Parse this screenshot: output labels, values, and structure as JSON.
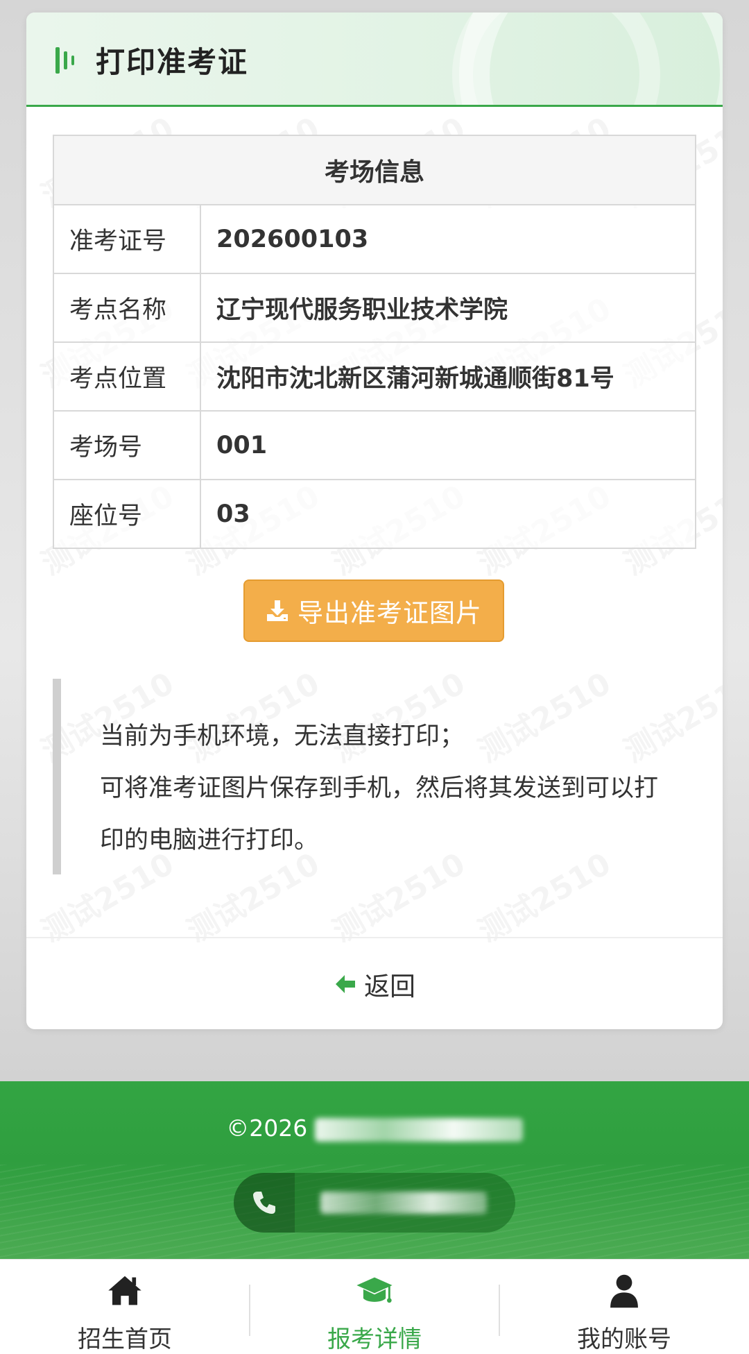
{
  "header": {
    "title": "打印准考证"
  },
  "watermark_text": "测试2510",
  "table": {
    "title": "考场信息",
    "rows": [
      {
        "label": "准考证号",
        "value": "202600103"
      },
      {
        "label": "考点名称",
        "value": "辽宁现代服务职业技术学院"
      },
      {
        "label": "考点位置",
        "value": "沈阳市沈北新区蒲河新城通顺街81号"
      },
      {
        "label": "考场号",
        "value": "001"
      },
      {
        "label": "座位号",
        "value": "03"
      }
    ]
  },
  "export_button": {
    "label": "导出准考证图片",
    "icon": "download-icon"
  },
  "notice": {
    "line1": "当前为手机环境，无法直接打印；",
    "line2": "可将准考证图片保存到手机，然后将其发送到可以打印的电脑进行打印。"
  },
  "back": {
    "label": "返回",
    "icon": "arrow-left-icon"
  },
  "footer": {
    "copyright_prefix": "©2026",
    "phone_icon": "phone-icon"
  },
  "nav": {
    "items": [
      {
        "label": "招生首页",
        "icon": "home-icon",
        "active": false
      },
      {
        "label": "报考详情",
        "icon": "graduation-cap-icon",
        "active": true
      },
      {
        "label": "我的账号",
        "icon": "user-icon",
        "active": false
      }
    ]
  },
  "colors": {
    "accent": "#3aa84a",
    "button": "#f3ae4a",
    "footer": "#33a543"
  }
}
